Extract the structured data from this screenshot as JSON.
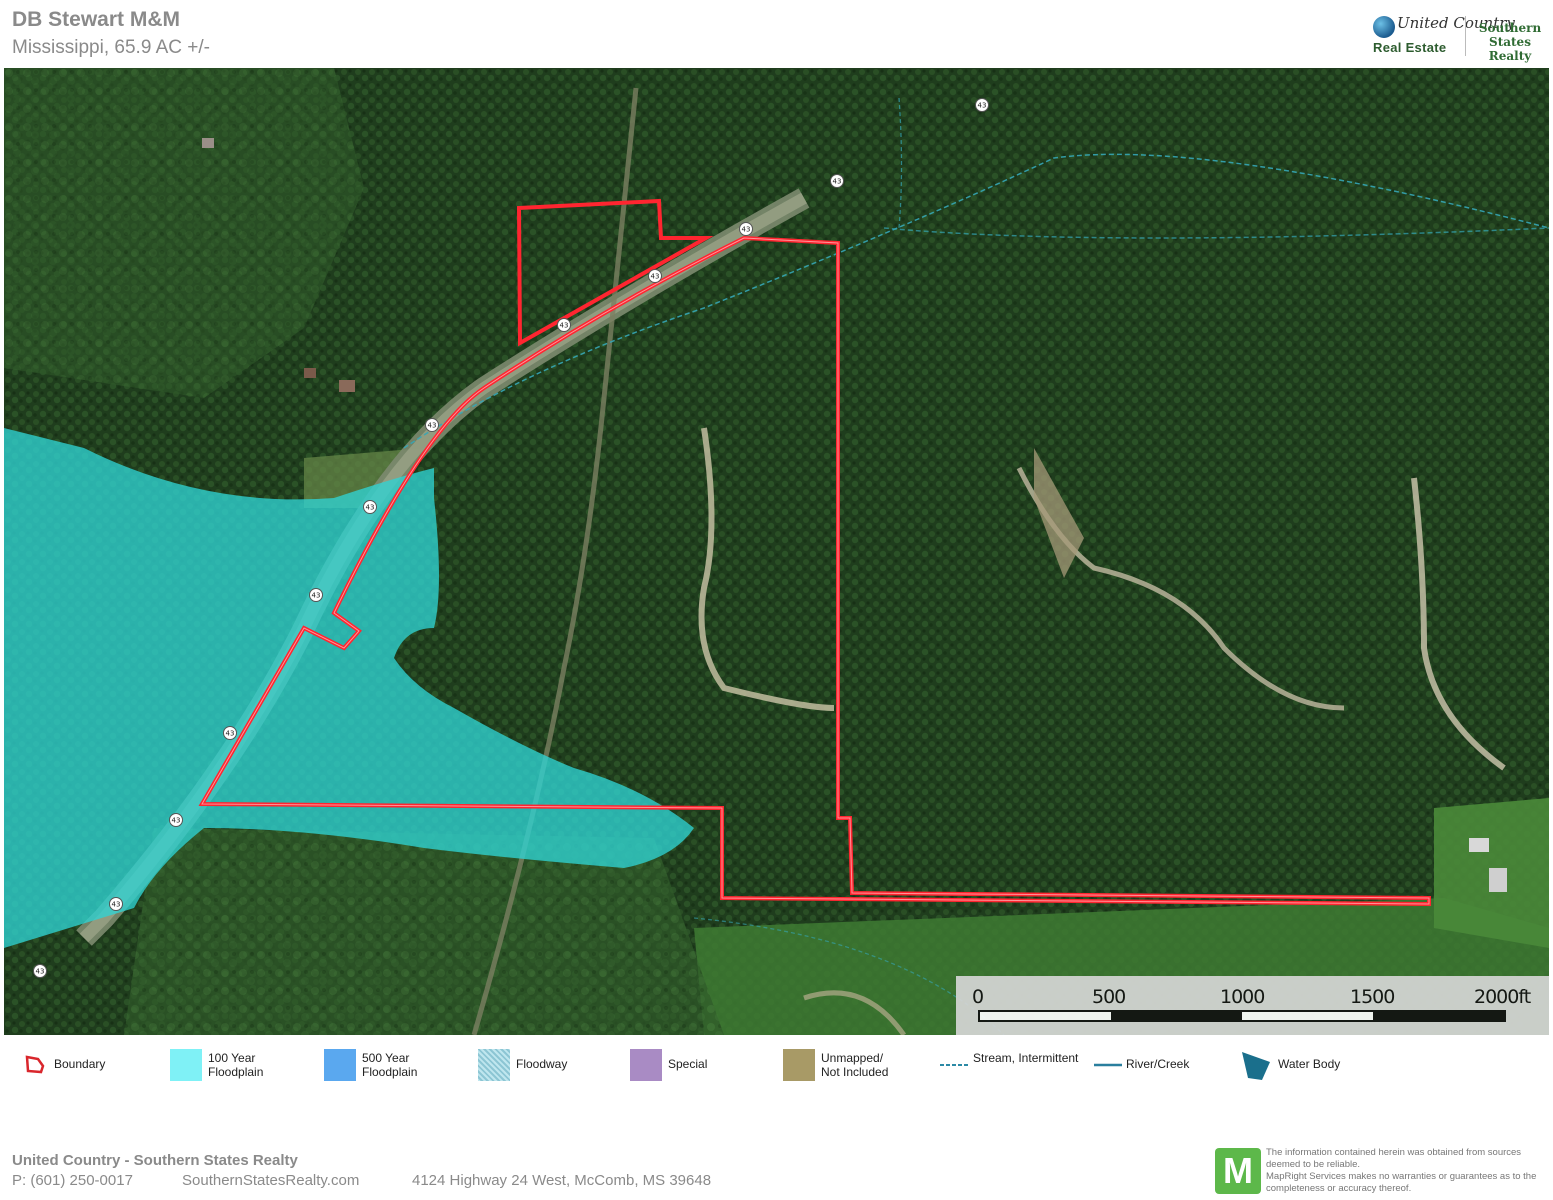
{
  "header": {
    "title": "DB Stewart M&M",
    "subtitle": "Mississippi, 65.9 AC +/-"
  },
  "brand": {
    "line1": "United Country",
    "line2": "Real Estate",
    "line3a": "Southern",
    "line3b": "States Realty"
  },
  "map": {
    "road_marker_label": "43",
    "boundary_color": "#e8202a",
    "floodplain_color": "#2ec8c8",
    "stream_color": "#2aa6b4"
  },
  "scale": {
    "ticks": [
      "0",
      "500",
      "1000",
      "1500",
      "2000ft"
    ]
  },
  "legend": [
    {
      "label": "Boundary",
      "color": "#d9262c",
      "icon": "boundary-icon"
    },
    {
      "label": "100 Year\nFloodplain",
      "color": "#7ff1f6",
      "icon": "floodplain-100-swatch"
    },
    {
      "label": "500 Year\nFloodplain",
      "color": "#5aa8ef",
      "icon": "floodplain-500-swatch"
    },
    {
      "label": "Floodway",
      "color": "#bfe6ee",
      "icon": "floodway-swatch"
    },
    {
      "label": "Special",
      "color": "#a98bc4",
      "icon": "special-swatch"
    },
    {
      "label": "Unmapped/\nNot Included",
      "color": "#a89a66",
      "icon": "unmapped-swatch"
    },
    {
      "label": "Stream,\nIntermittent",
      "color": "#2c8aa6",
      "icon": "stream-intermittent-icon"
    },
    {
      "label": "River/Creek",
      "color": "#2a7f9e",
      "icon": "river-creek-icon"
    },
    {
      "label": "Water Body",
      "color": "#1a6f8c",
      "icon": "water-body-icon"
    }
  ],
  "footer": {
    "company": "United Country - Southern States Realty",
    "phone": "P: (601) 250-0017",
    "website": "SouthernStatesRealty.com",
    "address": "4124 Highway 24 West, McComb, MS 39648",
    "logo_letter": "M",
    "disclaimer": "The information contained herein was obtained from sources deemed to be reliable.\nMapRight Services makes no warranties or guarantees as to the completeness or accuracy thereof."
  }
}
